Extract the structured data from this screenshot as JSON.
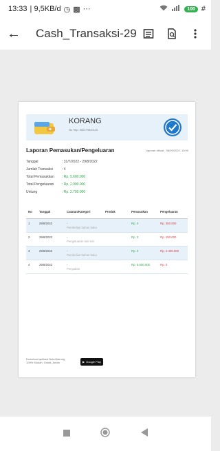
{
  "status": {
    "time": "13:33",
    "speed": "| 9,5KB/d",
    "more": "···",
    "battery": "100",
    "charge_glyph": "#"
  },
  "appbar": {
    "title": "Cash_Transaksi-29...."
  },
  "report": {
    "business_name": "KORANG",
    "phone": "No Telp: 082279540115",
    "title": "Laporan Pemasukan/Pengeluaran",
    "printed_at": "Laporan dibuat : 08/09/2022, 10:00",
    "info": [
      {
        "label": "Tanggal",
        "value": ": 31/7/2022 - 29/8/2022"
      },
      {
        "label": "Jumlah Transaksi",
        "value": ": 4"
      },
      {
        "label": "Total Pemasukkan",
        "value": ": Rp. 5.600.000"
      },
      {
        "label": "Total Pengeluaran",
        "value": ": Rp. 2.900.000"
      },
      {
        "label": "Untung",
        "value": ": Rp. 2.700.000"
      }
    ],
    "columns": [
      "No",
      "Tanggal",
      "Catatan/Kategori",
      "Produk",
      "Pemasukan",
      "Pengeluaran"
    ],
    "rows": [
      {
        "no": "1",
        "date": "29/8/2022",
        "category": "-",
        "note": "Pembelian bahan baku",
        "product": "",
        "income": "Rp. 0",
        "expense": "Rp. 350.000"
      },
      {
        "no": "2",
        "date": "29/8/2022",
        "category": "-",
        "note": "Pengeluaran lain lain",
        "product": "",
        "income": "Rp. 0",
        "expense": "Rp. 150.000"
      },
      {
        "no": "3",
        "date": "29/8/2022",
        "category": "-",
        "note": "Pembelian bahan baku",
        "product": "",
        "income": "Rp. 0",
        "expense": "Rp. 2.400.000"
      },
      {
        "no": "4",
        "date": "29/8/2022",
        "category": "-",
        "note": "Penjualan",
        "product": "",
        "income": "Rp. 5.600.000",
        "expense": "Rp. 0"
      }
    ],
    "footer": [
      "Download aplikasi BukuWarung",
      "100% Mudah, Gratis, Aman"
    ],
    "store_badge": "Google Play"
  }
}
